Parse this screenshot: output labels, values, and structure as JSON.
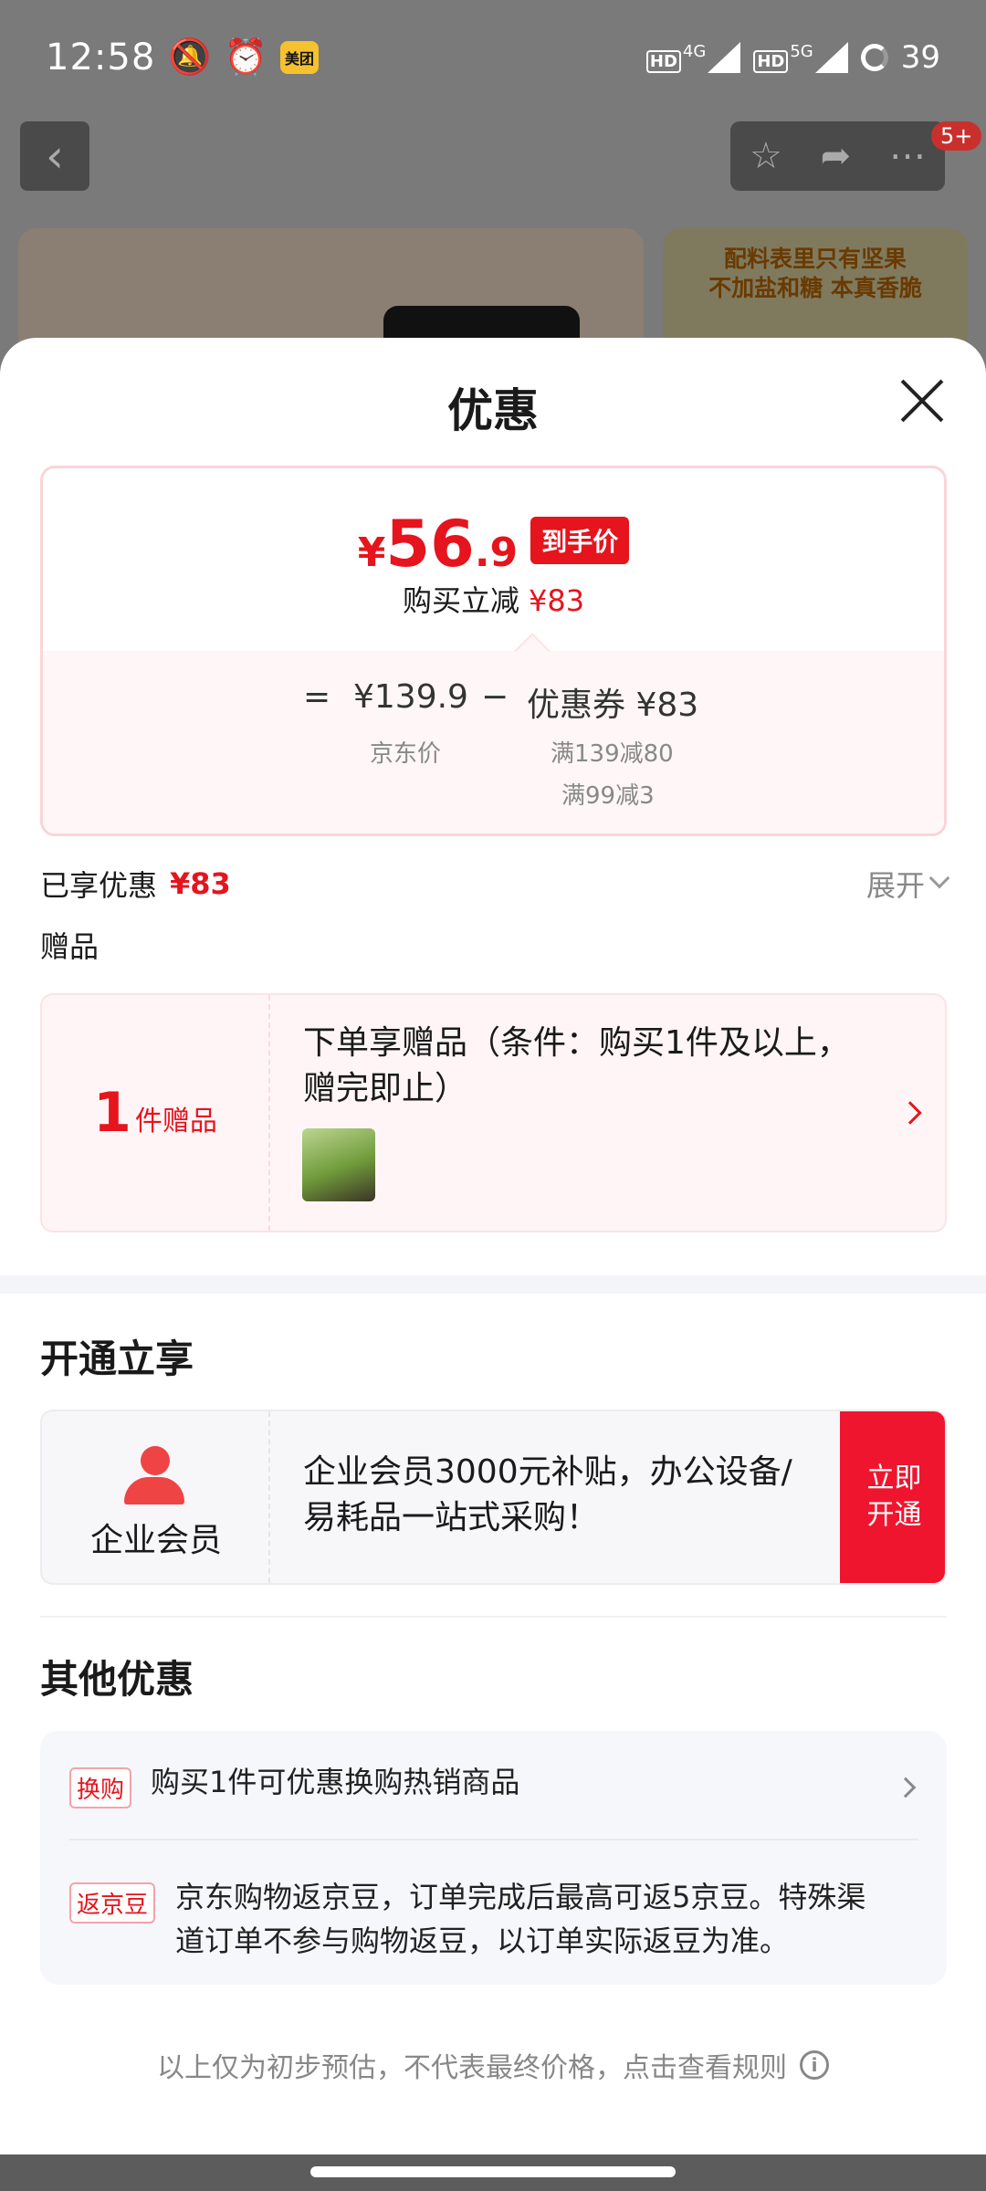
{
  "status_bar": {
    "time": "12:58",
    "app_badge": "美团",
    "net1": "4G",
    "net2": "5G",
    "hd": "HD",
    "battery": "39"
  },
  "background": {
    "badge": "5+",
    "banner_line1": "配料表里只有坚果",
    "banner_line2": "不加盐和糖 本真香脆"
  },
  "sheet": {
    "title": "优惠"
  },
  "price_card": {
    "currency": "¥",
    "price_int": "56",
    "price_dec": ".9",
    "final_tag": "到手价",
    "reduce_label": "购买立减",
    "reduce_value": "¥83",
    "eq": "=",
    "jd_price": "¥139.9",
    "minus": "−",
    "coupon": "优惠券 ¥83",
    "jd_price_label": "京东价",
    "coupon_rule1": "满139减80",
    "coupon_rule2": "满99减3"
  },
  "enjoyed": {
    "label": "已享优惠",
    "value": "¥83",
    "expand": "展开"
  },
  "gift": {
    "section_label": "赠品",
    "count": "1",
    "unit": "件赠品",
    "description": "下单享赠品（条件：购买1件及以上，赠完即止）"
  },
  "member": {
    "section_title": "开通立享",
    "name": "企业会员",
    "description": "企业会员3000元补贴，办公设备/易耗品一站式采购！",
    "button_line1": "立即",
    "button_line2": "开通"
  },
  "other": {
    "section_title": "其他优惠",
    "items": [
      {
        "tag": "换购",
        "text": "购买1件可优惠换购热销商品"
      },
      {
        "tag": "返京豆",
        "text": "京东购物返京豆，订单完成后最高可返5京豆。特殊渠道订单不参与购物返豆，以订单实际返豆为准。"
      }
    ]
  },
  "disclaimer": "以上仅为初步预估，不代表最终价格，点击查看规则",
  "colors": {
    "accent": "#e5141d",
    "open_button": "#f0152e"
  }
}
